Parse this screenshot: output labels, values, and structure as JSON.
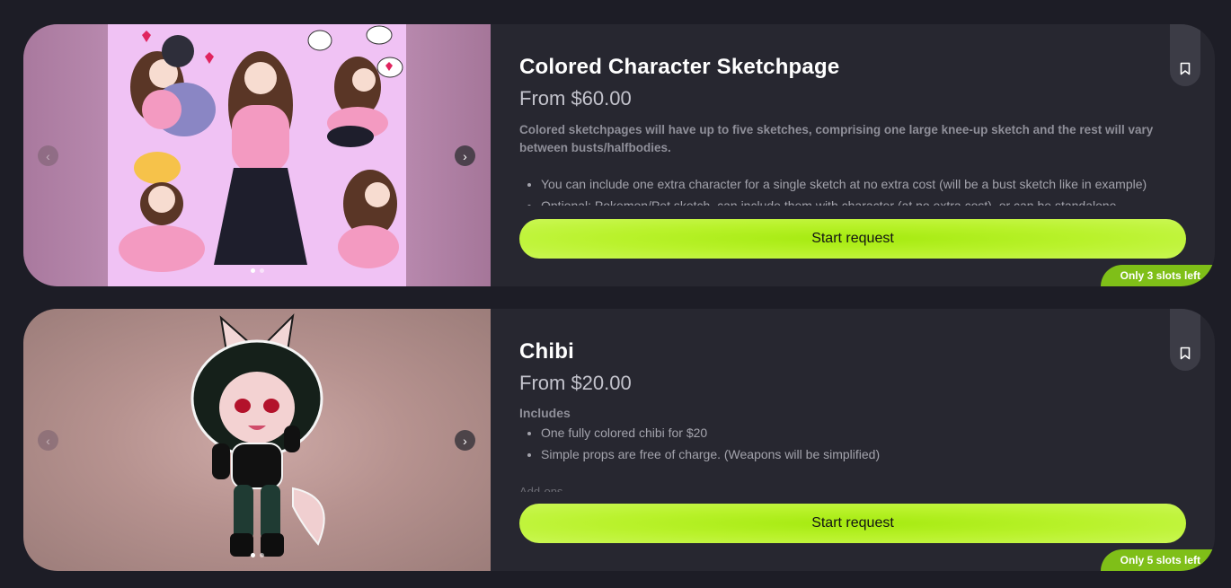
{
  "listings": [
    {
      "title": "Colored Character Sketchpage",
      "price": "From $60.00",
      "description": "Colored sketchpages will have up to five sketches, comprising one large knee-up sketch and the rest will vary between busts/halfbodies.",
      "bullets": [
        "You can include one extra character for a single sketch at no extra cost (will be a bust sketch like in example)",
        "Optional: Pokemon/Pet sketch, can include them with character (at no extra cost), or can be standalone"
      ],
      "cta_label": "Start request",
      "slots_badge": "Only 3 slots left",
      "prev_icon": "chevron-left-icon",
      "next_icon": "chevron-right-icon",
      "bookmark_icon": "bookmark-icon",
      "carousel_dots": 2,
      "active_dot": 1
    },
    {
      "title": "Chibi",
      "price": "From $20.00",
      "includes_label": "Includes",
      "bullets": [
        "One fully colored chibi for $20",
        "Simple props are free of charge. (Weapons will be simplified)"
      ],
      "addons_label": "Add-ons",
      "cta_label": "Start request",
      "slots_badge": "Only 5 slots left",
      "prev_icon": "chevron-left-icon",
      "next_icon": "chevron-right-icon",
      "bookmark_icon": "bookmark-icon",
      "carousel_dots": 2,
      "active_dot": 1
    }
  ],
  "colors": {
    "page_bg": "#1d1d26",
    "card_bg": "#272730",
    "accent_lime": "#b9f22b",
    "badge_green": "#7fbf18"
  }
}
